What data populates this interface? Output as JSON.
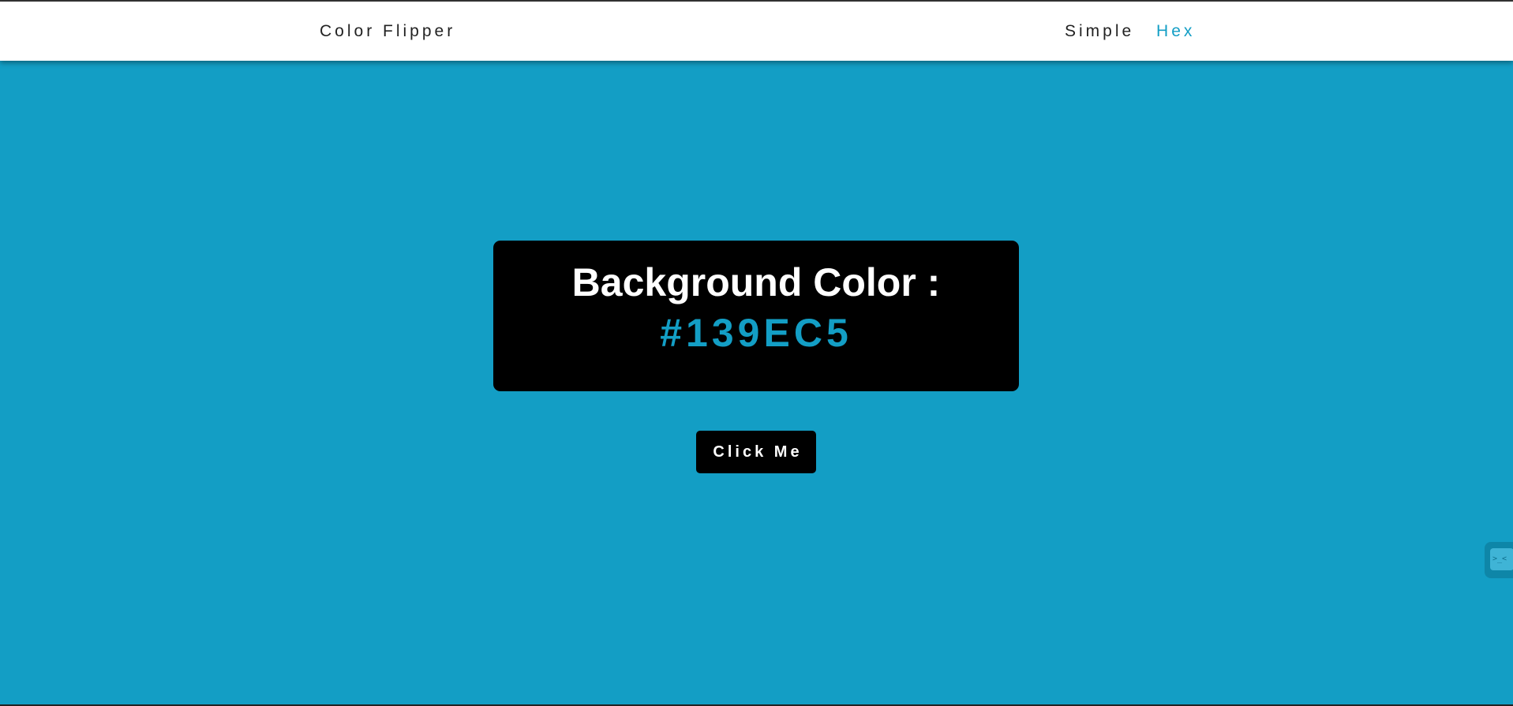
{
  "colors": {
    "background": "#139EC5",
    "navbar": "#ffffff",
    "accent": "#139EC5",
    "box": "#000000",
    "button": "#000000"
  },
  "navbar": {
    "brand": "Color Flipper",
    "links": [
      {
        "label": "Simple",
        "active": false
      },
      {
        "label": "Hex",
        "active": true
      }
    ]
  },
  "main": {
    "title": "Background Color :",
    "color_value": "#139EC5",
    "button_label": "Click Me"
  },
  "side_widget": {
    "icon": "terminal-icon",
    "glyph": ">_<"
  }
}
